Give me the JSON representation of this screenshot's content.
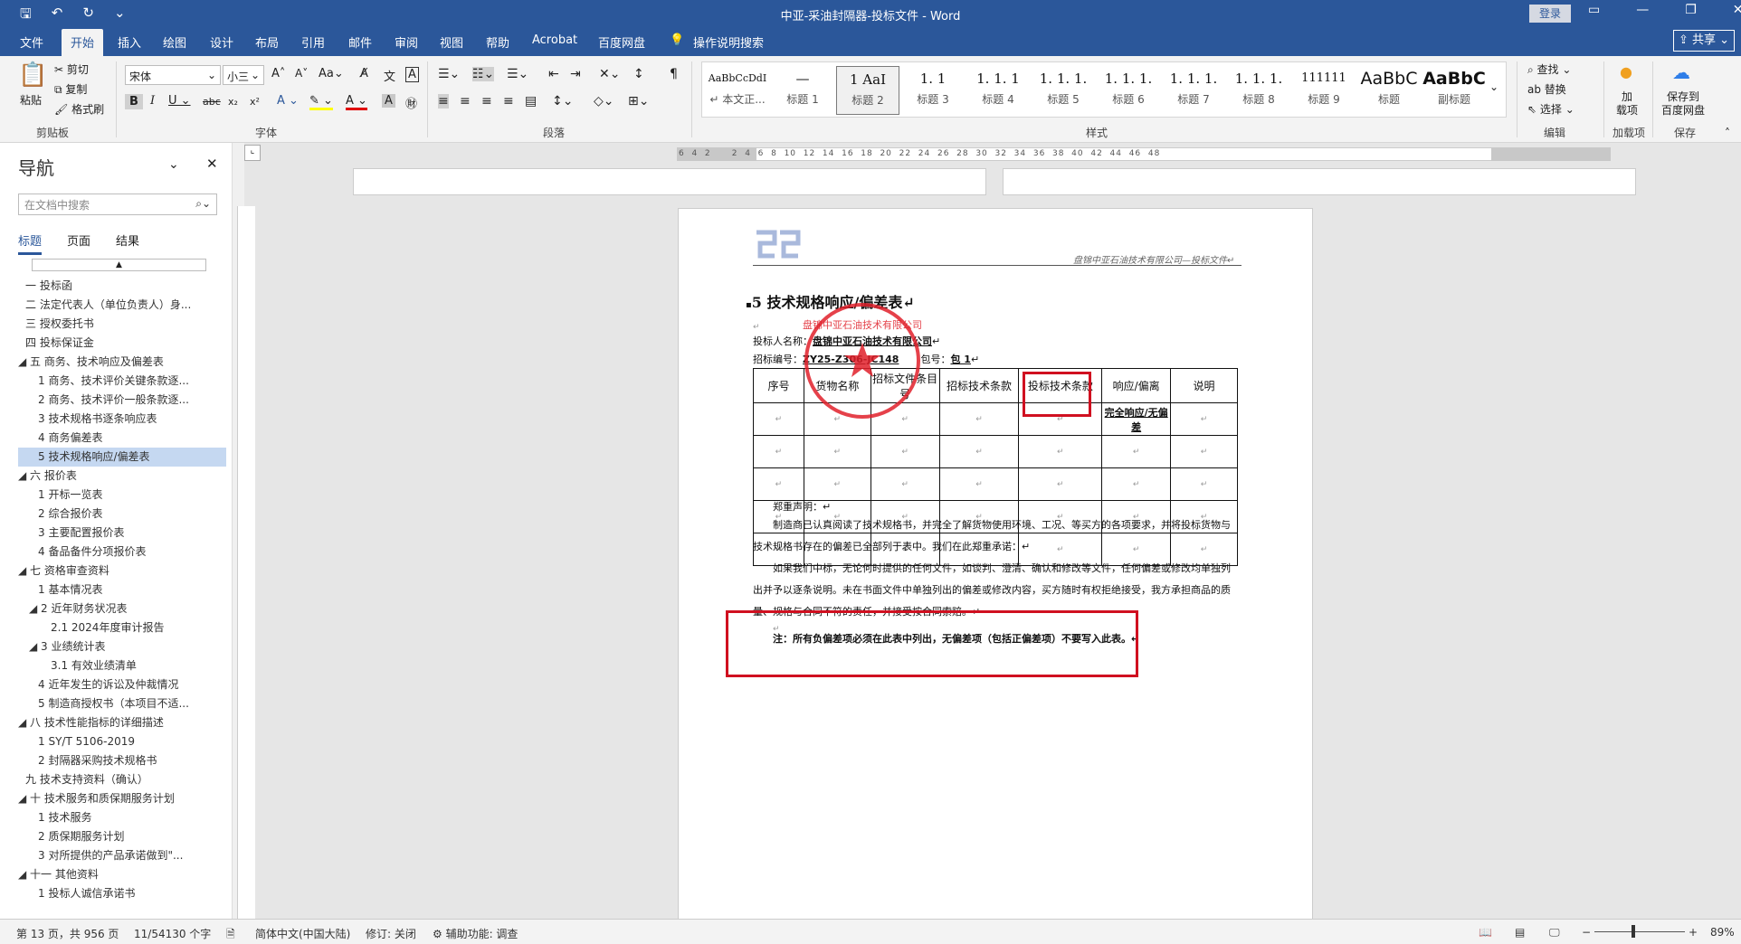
{
  "window": {
    "title": "中亚-采油封隔器-投标文件 - Word",
    "login_label": "登录"
  },
  "tabs": [
    "文件",
    "开始",
    "插入",
    "绘图",
    "设计",
    "布局",
    "引用",
    "邮件",
    "审阅",
    "视图",
    "帮助",
    "Acrobat",
    "百度网盘"
  ],
  "active_tab": "开始",
  "tell_me": "操作说明搜索",
  "share_label": "共享",
  "ribbon": {
    "clipboard": {
      "paste": "粘贴",
      "cut": "剪切",
      "copy": "复制",
      "format_painter": "格式刷",
      "group": "剪贴板"
    },
    "font": {
      "name": "宋体",
      "size": "小三",
      "group": "字体"
    },
    "paragraph": {
      "group": "段落"
    },
    "styles": {
      "group": "样式",
      "items": [
        {
          "sample": "AaBbCcDdI",
          "name": "↵ 本文正..."
        },
        {
          "sample": "—",
          "name": "标题 1"
        },
        {
          "sample": "1 AaI",
          "name": "标题 2"
        },
        {
          "sample": "1. 1",
          "name": "标题 3"
        },
        {
          "sample": "1. 1. 1",
          "name": "标题 4"
        },
        {
          "sample": "1. 1. 1.",
          "name": "标题 5"
        },
        {
          "sample": "1. 1. 1.",
          "name": "标题 6"
        },
        {
          "sample": "1. 1. 1.",
          "name": "标题 7"
        },
        {
          "sample": "1. 1. 1.",
          "name": "标题 8"
        },
        {
          "sample": "111111",
          "name": "标题 9"
        },
        {
          "sample": "AaBbC",
          "name": "标题"
        },
        {
          "sample": "AaBbC",
          "name": "副标题"
        }
      ],
      "selected_index": 2
    },
    "editing": {
      "find": "查找",
      "replace": "替换",
      "select": "选择",
      "group": "编辑"
    },
    "addins": {
      "label": "加\n载项",
      "group": "加载项"
    },
    "save": {
      "label": "保存到\n百度网盘",
      "group": "保存"
    }
  },
  "nav": {
    "title": "导航",
    "search_placeholder": "在文档中搜索",
    "tabs": [
      "标题",
      "页面",
      "结果"
    ],
    "items": [
      {
        "text": "一 投标函",
        "indent": 0
      },
      {
        "text": "二 法定代表人（单位负责人）身...",
        "indent": 0
      },
      {
        "text": "三 授权委托书",
        "indent": 0
      },
      {
        "text": "四 投标保证金",
        "indent": 0
      },
      {
        "text": "◢ 五 商务、技术响应及偏差表",
        "indent": 0
      },
      {
        "text": "1 商务、技术评价关键条款逐...",
        "indent": 1
      },
      {
        "text": "2 商务、技术评价一般条款逐...",
        "indent": 1
      },
      {
        "text": "3 技术规格书逐条响应表",
        "indent": 1
      },
      {
        "text": "4 商务偏差表",
        "indent": 1
      },
      {
        "text": "5 技术规格响应/偏差表",
        "indent": 1,
        "selected": true
      },
      {
        "text": "◢ 六 报价表",
        "indent": 0
      },
      {
        "text": "1 开标一览表",
        "indent": 1
      },
      {
        "text": "2 综合报价表",
        "indent": 1
      },
      {
        "text": "3 主要配置报价表",
        "indent": 1
      },
      {
        "text": "4 备品备件分项报价表",
        "indent": 1
      },
      {
        "text": "◢ 七 资格审查资料",
        "indent": 0
      },
      {
        "text": "1 基本情况表",
        "indent": 1
      },
      {
        "text": "◢ 2 近年财务状况表",
        "indent": 1
      },
      {
        "text": "2.1 2024年度审计报告",
        "indent": 2
      },
      {
        "text": "◢ 3 业绩统计表",
        "indent": 1
      },
      {
        "text": "3.1 有效业绩清单",
        "indent": 2
      },
      {
        "text": "4 近年发生的诉讼及仲裁情况",
        "indent": 1
      },
      {
        "text": "5 制造商授权书（本项目不适...",
        "indent": 1
      },
      {
        "text": "◢ 八 技术性能指标的详细描述",
        "indent": 0
      },
      {
        "text": "1 SY/T 5106-2019",
        "indent": 1
      },
      {
        "text": "2 封隔器采购技术规格书",
        "indent": 1
      },
      {
        "text": "九 技术支持资料（确认）",
        "indent": 0
      },
      {
        "text": "◢ 十 技术服务和质保期服务计划",
        "indent": 0
      },
      {
        "text": "1 技术服务",
        "indent": 1
      },
      {
        "text": "2 质保期服务计划",
        "indent": 1
      },
      {
        "text": "3 对所提供的产品承诺做到\"...",
        "indent": 1
      },
      {
        "text": "◢ 十一 其他资料",
        "indent": 0
      },
      {
        "text": "1 投标人诚信承诺书",
        "indent": 1
      }
    ]
  },
  "document": {
    "header_text": "盘锦中亚石油技术有限公司—投标文件↵",
    "heading": "5 技术规格响应/偏差表↵",
    "bidder_label": "投标人名称：",
    "bidder_name": "盘锦中亚石油技术有限公司",
    "tender_no_label": "招标编号：",
    "tender_no": "ZY25-Z306-JC148",
    "package_label": "包号：",
    "package": "包 1",
    "table_headers": [
      "序号",
      "货物名称",
      "招标文件条目号",
      "招标技术条款",
      "投标技术条款",
      "响应/偏离",
      "说明"
    ],
    "table_response_cell": "完全响应/无偏差",
    "table_rows": 5,
    "declaration_title": "郑重声明：↵",
    "para1": "制造商已认真阅读了技术规格书，并完全了解货物使用环境、工况、等买方的各项要求，并将投标货物与技术规格书存在的偏差已全部列于表中。我们在此郑重承诺：↵",
    "para2": "如果我们中标，无论何时提供的任何文件，如谈判、澄清、确认和修改等文件，任何偏差或修改均单独列出并予以逐条说明。未在书面文件中单独列出的偏差或修改内容，买方随时有权拒绝接受，我方承担商品的质量、规格与合同不符的责任，并接受按合同索赔。↵",
    "note": "注：所有负偏差项必须在此表中列出，无偏差项（包括正偏差项）不要写入此表。↵",
    "seal_text": "盘锦中亚石油技术有限公司"
  },
  "statusbar": {
    "page": "第 13 页，共 956 页",
    "words": "11/54130 个字",
    "language": "简体中文(中国大陆)",
    "track": "修订: 关闭",
    "accessibility": "辅助功能: 调查",
    "zoom": "89%"
  },
  "colors": {
    "accent": "#2b579a",
    "highlight_box": "#d01020",
    "seal": "#e0202a"
  }
}
